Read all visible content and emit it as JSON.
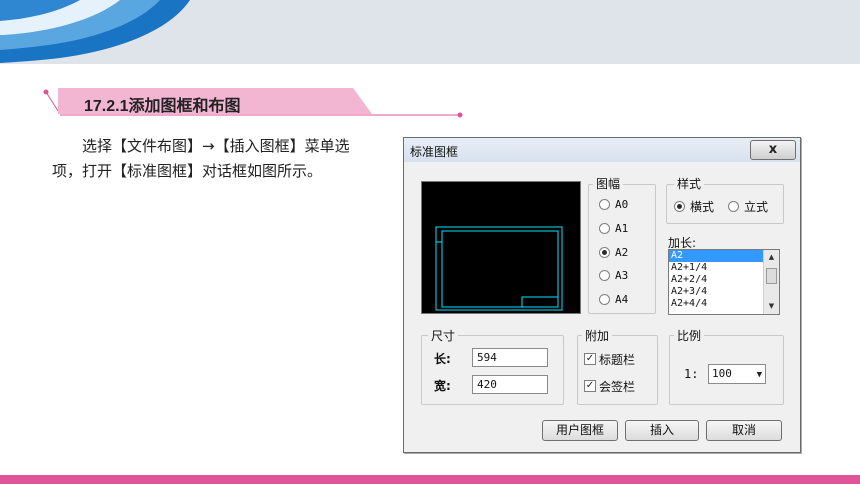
{
  "section": {
    "title": "17.2.1添加图框和布图"
  },
  "body_text": "选择【文件布图】→【插入图框】菜单选项，打开【标准图框】对话框如图所示。",
  "colors": {
    "accent_pink": "#e0559a",
    "tab_pink": "#f2b6d3",
    "header_grey": "#dfe4ea",
    "wave_blue": "#1a74c4"
  },
  "dialog": {
    "title": "标准图框",
    "close_label": "x",
    "sheet_size": {
      "label": "图幅",
      "options": [
        "A0",
        "A1",
        "A2",
        "A3",
        "A4"
      ],
      "selected": "A2"
    },
    "style": {
      "label": "样式",
      "options": [
        "横式",
        "立式"
      ],
      "selected": "横式"
    },
    "extend": {
      "label": "加长:",
      "items": [
        "A2",
        "A2+1/4",
        "A2+2/4",
        "A2+3/4",
        "A2+4/4"
      ],
      "selected": "A2"
    },
    "size": {
      "label": "尺寸",
      "length_label": "长:",
      "length_value": "594",
      "width_label": "宽:",
      "width_value": "420"
    },
    "attach": {
      "label": "附加",
      "title_block_label": "标题栏",
      "title_block_checked": true,
      "sign_block_label": "会签栏",
      "sign_block_checked": true
    },
    "scale": {
      "label": "比例",
      "prefix": "1:",
      "value": "100"
    },
    "buttons": {
      "user_frame": "用户图框",
      "insert": "插入",
      "cancel": "取消"
    }
  }
}
